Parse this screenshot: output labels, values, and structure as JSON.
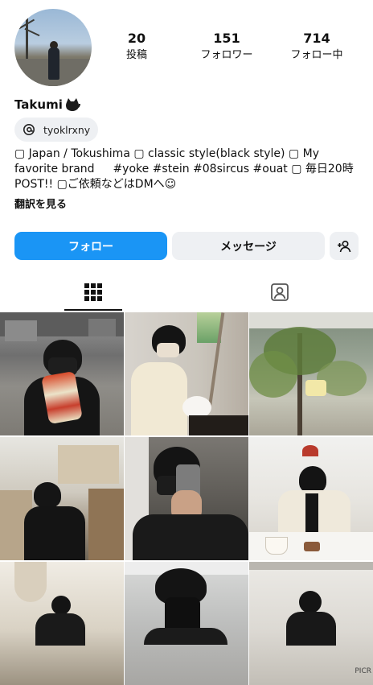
{
  "profile": {
    "username": "Takumi",
    "threads_handle": "tyoklrxny",
    "stats": [
      {
        "value": "20",
        "label": "投稿"
      },
      {
        "value": "151",
        "label": "フォロワー"
      },
      {
        "value": "714",
        "label": "フォロー中"
      }
    ],
    "bio_lines": [
      "▢ Japan / Tokushima ▢ classic style(black style) ▢ My",
      "favorite brand  　#yoke #stein #08sircus #ouat ▢ 毎日20時",
      "POST!! ▢ご依頼などはDMへ☺"
    ],
    "translate_label": "翻訳を見る"
  },
  "actions": {
    "follow_label": "フォロー",
    "message_label": "メッセージ"
  },
  "tabs": [
    {
      "name": "posts-grid",
      "icon": "grid-icon",
      "active": true
    },
    {
      "name": "tagged",
      "icon": "tagged-person-icon",
      "active": false
    }
  ],
  "grid_watermark": "PICR"
}
